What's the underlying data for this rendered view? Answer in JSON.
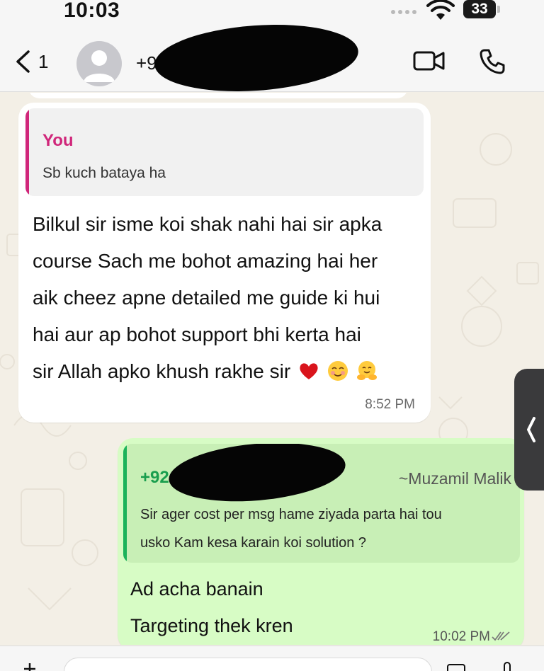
{
  "status_bar": {
    "time": "10:03",
    "battery": "33"
  },
  "header": {
    "back_count": "1",
    "contact_name": "+92 311",
    "icons": [
      "back-chevron",
      "avatar-placeholder",
      "video-camera",
      "phone"
    ]
  },
  "messages": [
    {
      "direction": "incoming",
      "quote": {
        "author": "You",
        "text": "Sb kuch bataya ha"
      },
      "lines": [
        "Bilkul sir isme koi shak nahi hai sir apka",
        "course Sach me bohot amazing hai her",
        "aik cheez apne detailed me guide ki hui",
        "hai aur ap bohot support bhi kerta hai",
        "sir Allah apko khush rakhe sir"
      ],
      "emojis": [
        "red-heart",
        "smiling-face",
        "hugging-face"
      ],
      "time": "8:52 PM"
    },
    {
      "direction": "outgoing",
      "quote": {
        "author": "+92 31",
        "group_name": "~Muzamil Malik",
        "lines": [
          "Sir ager cost per msg hame ziyada parta hai tou",
          "usko Kam kesa karain koi solution ?"
        ]
      },
      "lines": [
        "Ad acha banain",
        "Targeting thek kren"
      ],
      "time": "10:02 PM",
      "status": "read"
    }
  ],
  "colors": {
    "incoming_bubble": "#ffffff",
    "outgoing_bubble": "#d7fcc5",
    "quote_you_accent": "#d0267a",
    "quote_other_accent": "#1bb35a",
    "wallpaper": "#f3efe6"
  }
}
